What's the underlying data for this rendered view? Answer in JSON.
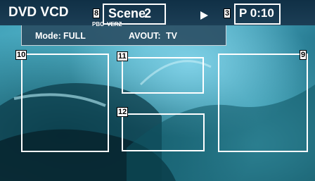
{
  "header": {
    "title": "DVD VCD",
    "scene_label": "Scene",
    "scene_number": "2",
    "play_icon": "play-icon",
    "time": "P 0:10"
  },
  "mode_panel": {
    "pbc_label": "PBC",
    "verz_label": "VERZ",
    "mode_label": "Mode:",
    "mode_value": "FULL",
    "avout_label": "AVOUT:",
    "avout_value": "TV"
  },
  "callouts": {
    "scene": "8",
    "time": "3",
    "left_zone": "10",
    "top_center_zone": "11",
    "bottom_center_zone": "12",
    "right_zone": "9"
  },
  "colors": {
    "topbar": "#103046",
    "panel": "#284a60",
    "text": "#ffffff",
    "box_border": "#ffffff"
  }
}
